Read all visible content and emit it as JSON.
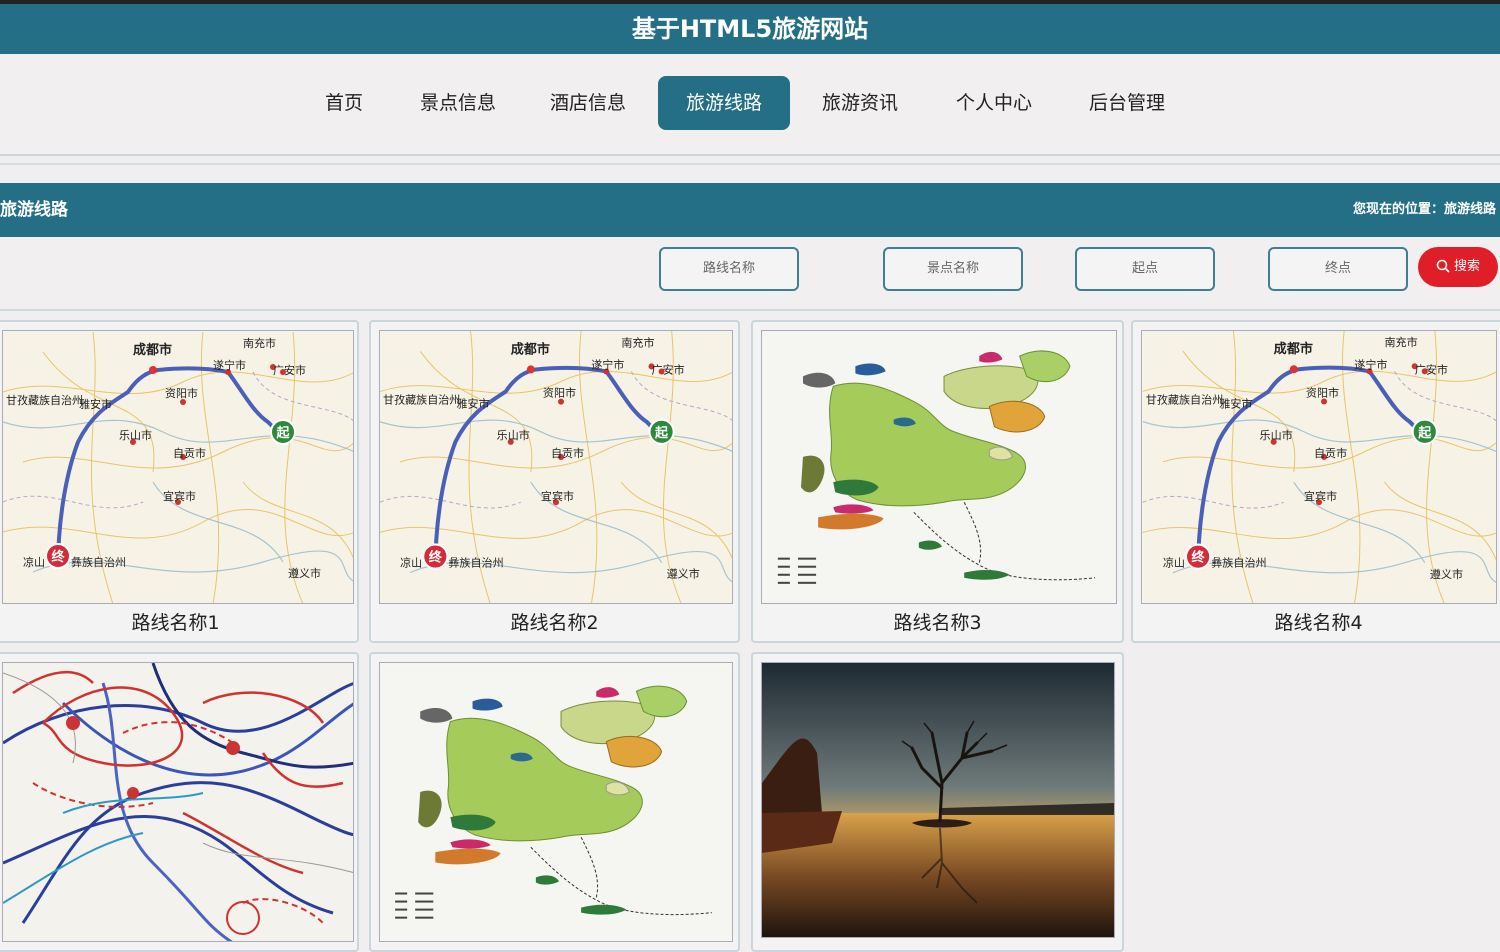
{
  "header": {
    "site_title": "基于HTML5旅游网站"
  },
  "nav": {
    "items": [
      {
        "label": "首页",
        "active": false
      },
      {
        "label": "景点信息",
        "active": false
      },
      {
        "label": "酒店信息",
        "active": false
      },
      {
        "label": "旅游线路",
        "active": true
      },
      {
        "label": "旅游资讯",
        "active": false
      },
      {
        "label": "个人中心",
        "active": false
      },
      {
        "label": "后台管理",
        "active": false
      }
    ]
  },
  "section": {
    "title": "旅游线路",
    "breadcrumb": "您现在的位置：旅游线路"
  },
  "search": {
    "route_name_placeholder": "路线名称",
    "spot_name_placeholder": "景点名称",
    "start_placeholder": "起点",
    "end_placeholder": "终点",
    "button_label": "搜索"
  },
  "map_labels": {
    "chengdu": "成都市",
    "nanchong": "南充市",
    "suining": "遂宁市",
    "guangan": "广安市",
    "ganzi": "甘孜藏族自治州",
    "yaan": "雅安市",
    "ziyang": "资阳市",
    "leshan": "乐山市",
    "zigong": "自贡市",
    "yibin": "宜宾市",
    "zunyi": "遵义市",
    "liangshan": "凉山",
    "liangshan_suffix": "彝族自治州",
    "start_mark": "起",
    "end_mark": "终"
  },
  "routes": [
    {
      "name": "路线名称1",
      "image": "route-map"
    },
    {
      "name": "路线名称2",
      "image": "route-map"
    },
    {
      "name": "路线名称3",
      "image": "scenic-area-map"
    },
    {
      "name": "路线名称4",
      "image": "route-map"
    },
    {
      "name": "",
      "image": "historic-route-map"
    },
    {
      "name": "",
      "image": "scenic-area-map"
    },
    {
      "name": "",
      "image": "sunset-lake-photo"
    }
  ],
  "colors": {
    "primary": "#246f86",
    "search_button": "#e01e27",
    "route_line": "#4a5fb8"
  }
}
